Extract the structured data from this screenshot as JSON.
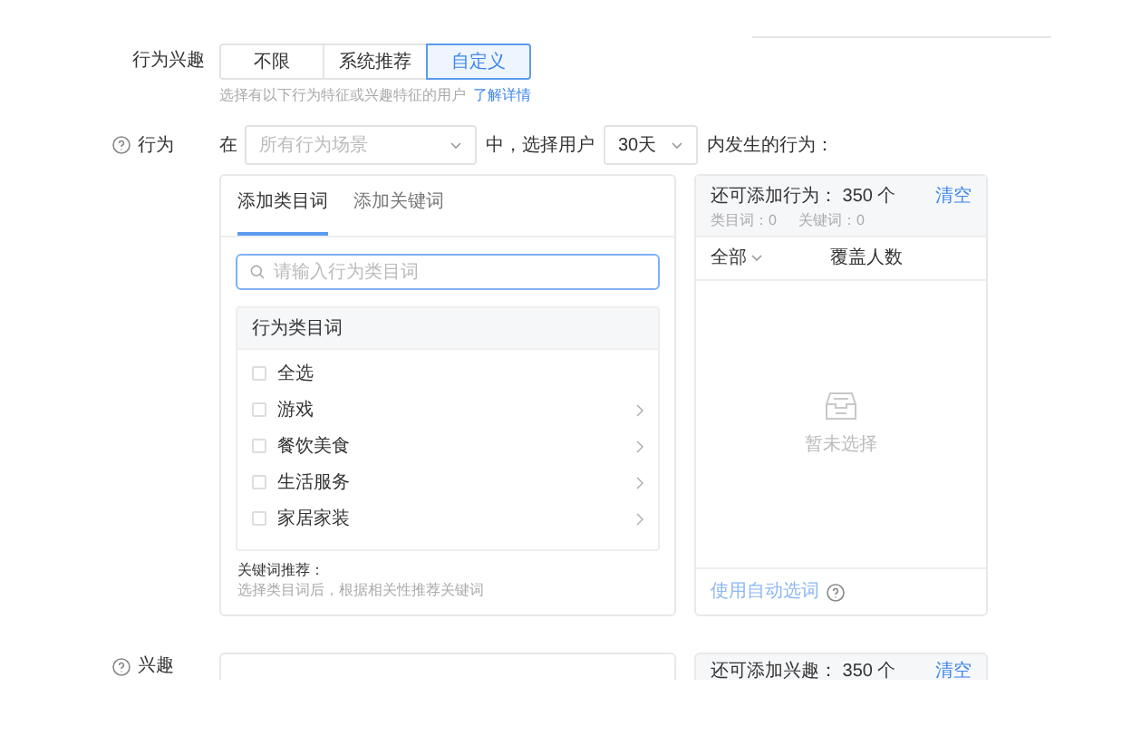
{
  "behavior_interest": {
    "label": "行为兴趣",
    "options": [
      {
        "label": "不限",
        "selected": false
      },
      {
        "label": "系统推荐",
        "selected": false
      },
      {
        "label": "自定义",
        "selected": true
      }
    ],
    "hint": "选择有以下行为特征或兴趣特征的用户",
    "hint_link": "了解详情"
  },
  "behavior": {
    "label": "行为",
    "prefix": "在",
    "scene_select": {
      "placeholder": "所有行为场景"
    },
    "middle": "中，选择用户",
    "days_select": {
      "value": "30天"
    },
    "suffix": "内发生的行为：",
    "tabs": [
      {
        "label": "添加类目词",
        "selected": true
      },
      {
        "label": "添加关键词",
        "selected": false
      }
    ],
    "search": {
      "placeholder": "请输入行为类目词"
    },
    "list_header": "行为类目词",
    "items": [
      {
        "label": "全选",
        "checked": false,
        "has_children": false
      },
      {
        "label": "游戏",
        "checked": false,
        "has_children": true
      },
      {
        "label": "餐饮美食",
        "checked": false,
        "has_children": true
      },
      {
        "label": "生活服务",
        "checked": false,
        "has_children": true
      },
      {
        "label": "家居家装",
        "checked": false,
        "has_children": true
      }
    ],
    "keyword_title": "关键词推荐：",
    "keyword_hint": "选择类目词后，根据相关性推荐关键词",
    "summary": {
      "title": "还可添加行为：",
      "count": "350 个",
      "clear": "清空",
      "category_count": "类目词：0",
      "keyword_count": "关键词：0"
    },
    "columns": {
      "filter": "全部",
      "coverage": "覆盖人数"
    },
    "empty": "暂未选择",
    "auto_select": "使用自动选词"
  },
  "interest": {
    "label": "兴趣",
    "summary": {
      "title": "还可添加兴趣：",
      "count": "350 个",
      "clear": "清空"
    }
  }
}
